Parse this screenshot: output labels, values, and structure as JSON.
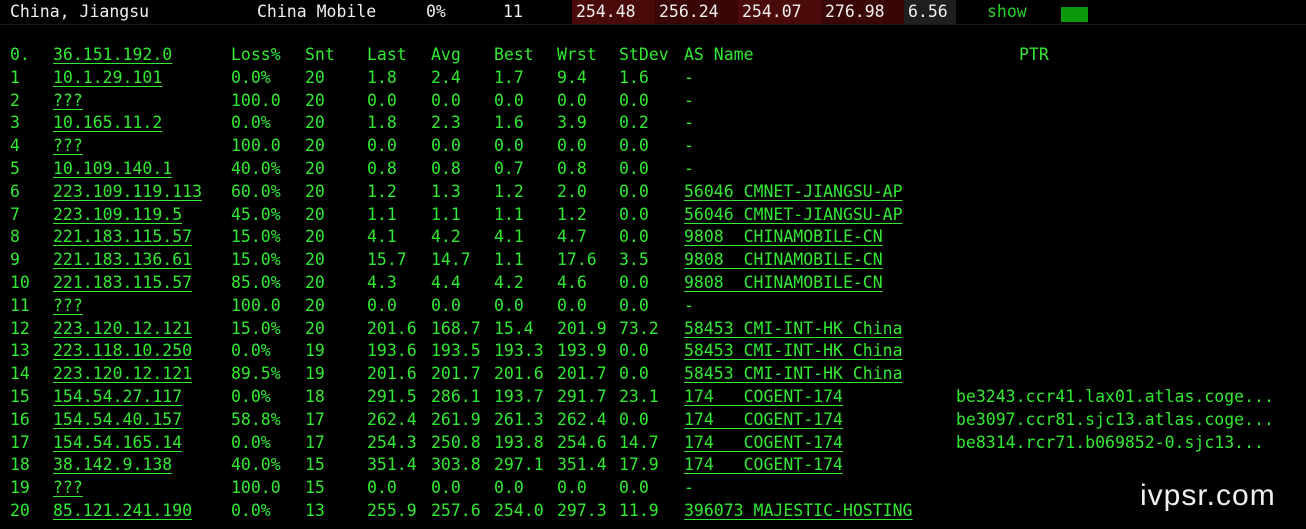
{
  "summary": {
    "location": "China, Jiangsu",
    "provider": "China Mobile",
    "loss": "0%",
    "hops": "11",
    "v1": "254.48",
    "v2": "256.24",
    "v3": "254.07",
    "v4": "276.98",
    "v5": "6.56",
    "show_label": "show",
    "colors": {
      "text": "#f0f0f0",
      "show": "#2bd02b",
      "block": "#0a9a0a",
      "cell1": "#4a0a0a",
      "cell2": "#3a0505",
      "cell3": "#4a0a0a",
      "cell4": "#3a0505",
      "cell5": "#1f1f1f"
    }
  },
  "table": {
    "headers": [
      "0.",
      "36.151.192.0",
      "Loss%",
      "Snt",
      "Last",
      "Avg",
      "Best",
      "Wrst",
      "StDev",
      "AS Name",
      "PTR"
    ],
    "rows": [
      [
        "1",
        "10.1.29.101",
        "0.0%",
        "20",
        "1.8",
        "2.4",
        "1.7",
        "9.4",
        "1.6",
        "-",
        ""
      ],
      [
        "2",
        "???",
        "100.0",
        "20",
        "0.0",
        "0.0",
        "0.0",
        "0.0",
        "0.0",
        "-",
        ""
      ],
      [
        "3",
        "10.165.11.2",
        "0.0%",
        "20",
        "1.8",
        "2.3",
        "1.6",
        "3.9",
        "0.2",
        "-",
        ""
      ],
      [
        "4",
        "???",
        "100.0",
        "20",
        "0.0",
        "0.0",
        "0.0",
        "0.0",
        "0.0",
        "-",
        ""
      ],
      [
        "5",
        "10.109.140.1",
        "40.0%",
        "20",
        "0.8",
        "0.8",
        "0.7",
        "0.8",
        "0.0",
        "-",
        ""
      ],
      [
        "6",
        "223.109.119.113",
        "60.0%",
        "20",
        "1.2",
        "1.3",
        "1.2",
        "2.0",
        "0.0",
        "56046 CMNET-JIANGSU-AP",
        ""
      ],
      [
        "7",
        "223.109.119.5",
        "45.0%",
        "20",
        "1.1",
        "1.1",
        "1.1",
        "1.2",
        "0.0",
        "56046 CMNET-JIANGSU-AP",
        ""
      ],
      [
        "8",
        "221.183.115.57",
        "15.0%",
        "20",
        "4.1",
        "4.2",
        "4.1",
        "4.7",
        "0.0",
        "9808  CHINAMOBILE-CN",
        ""
      ],
      [
        "9",
        "221.183.136.61",
        "15.0%",
        "20",
        "15.7",
        "14.7",
        "1.1",
        "17.6",
        "3.5",
        "9808  CHINAMOBILE-CN",
        ""
      ],
      [
        "10",
        "221.183.115.57",
        "85.0%",
        "20",
        "4.3",
        "4.4",
        "4.2",
        "4.6",
        "0.0",
        "9808  CHINAMOBILE-CN",
        ""
      ],
      [
        "11",
        "???",
        "100.0",
        "20",
        "0.0",
        "0.0",
        "0.0",
        "0.0",
        "0.0",
        "-",
        ""
      ],
      [
        "12",
        "223.120.12.121",
        "15.0%",
        "20",
        "201.6",
        "168.7",
        "15.4",
        "201.9",
        "73.2",
        "58453 CMI-INT-HK China",
        ""
      ],
      [
        "13",
        "223.118.10.250",
        "0.0%",
        "19",
        "193.6",
        "193.5",
        "193.3",
        "193.9",
        "0.0",
        "58453 CMI-INT-HK China",
        ""
      ],
      [
        "14",
        "223.120.12.121",
        "89.5%",
        "19",
        "201.6",
        "201.7",
        "201.6",
        "201.7",
        "0.0",
        "58453 CMI-INT-HK China",
        ""
      ],
      [
        "15",
        "154.54.27.117",
        "0.0%",
        "18",
        "291.5",
        "286.1",
        "193.7",
        "291.7",
        "23.1",
        "174   COGENT-174",
        "be3243.ccr41.lax01.atlas.coge..."
      ],
      [
        "16",
        "154.54.40.157",
        "58.8%",
        "17",
        "262.4",
        "261.9",
        "261.3",
        "262.4",
        "0.0",
        "174   COGENT-174",
        "be3097.ccr81.sjc13.atlas.coge..."
      ],
      [
        "17",
        "154.54.165.14",
        "0.0%",
        "17",
        "254.3",
        "250.8",
        "193.8",
        "254.6",
        "14.7",
        "174   COGENT-174",
        "be8314.rcr71.b069852-0.sjc13..."
      ],
      [
        "18",
        "38.142.9.138",
        "40.0%",
        "15",
        "351.4",
        "303.8",
        "297.1",
        "351.4",
        "17.9",
        "174   COGENT-174",
        ""
      ],
      [
        "19",
        "???",
        "100.0",
        "15",
        "0.0",
        "0.0",
        "0.0",
        "0.0",
        "0.0",
        "-",
        ""
      ],
      [
        "20",
        "85.121.241.190",
        "0.0%",
        "13",
        "255.9",
        "257.6",
        "254.0",
        "297.3",
        "11.9",
        "396073 MAJESTIC-HOSTING",
        ""
      ]
    ]
  },
  "watermark": "ivpsr.com"
}
